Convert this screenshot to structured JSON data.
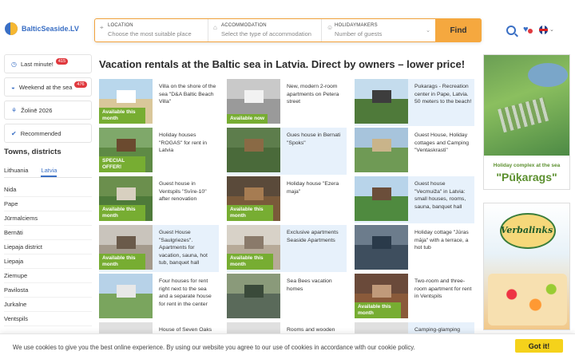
{
  "header": {
    "logo_text": "BalticSeaside.LV",
    "fields": [
      {
        "label": "LOCATION",
        "placeholder": "Choose the most suitable place"
      },
      {
        "label": "ACCOMMODATION",
        "placeholder": "Select the type of accommodation"
      },
      {
        "label": "HOLIDAYMAKERS",
        "placeholder": "Number of guests"
      }
    ],
    "find_label": "Find"
  },
  "sidebar": {
    "buttons": [
      {
        "label": "Last minute!",
        "badge": "415",
        "icon": "clock-icon"
      },
      {
        "label": "Weekend at the sea",
        "badge": "476",
        "icon": "wave-icon"
      },
      {
        "label": "Žolinē 2026",
        "badge": "",
        "icon": "grass-icon"
      },
      {
        "label": "Recommended",
        "badge": "",
        "icon": "thumbs-up-icon"
      }
    ],
    "towns_title": "Towns, districts",
    "tabs": [
      "Lithuania",
      "Latvia"
    ],
    "active_tab": "Latvia",
    "towns": [
      "Nida",
      "Pape",
      "Jūrmalciems",
      "Bernāti",
      "Liepaja district",
      "Liepaja",
      "Ziemupe",
      "Pavilosta",
      "Jurkalne",
      "Ventspils"
    ]
  },
  "main": {
    "title": "Vacation rentals at the Baltic sea in Latvia. Direct by owners – lower price!",
    "listings": [
      {
        "desc": "Villa on the shore of the sea \"D&A Baltic Beach Villa\"",
        "badge": "Available this month",
        "hl": false
      },
      {
        "desc": "New, modern 2-room apartments on Petera street",
        "badge": "Available now",
        "hl": false
      },
      {
        "desc": "Pukarags - Recreation center in Pape, Latvia. 50 meters to the beach!",
        "badge": "",
        "hl": true
      },
      {
        "desc": "Holiday houses \"ROGAS\" for rent in Latvia",
        "badge": "SPECIAL OFFER!",
        "hl": false
      },
      {
        "desc": "Gues house in Bernati \"Spoks\"",
        "badge": "",
        "hl": true
      },
      {
        "desc": "Guest House, Holiday cottages and Camping \"Ventaskrasti\"",
        "badge": "",
        "hl": false
      },
      {
        "desc": "Guest house in Ventspils \"Svīre-10\" after renovation",
        "badge": "Available this month",
        "hl": false
      },
      {
        "desc": "Holiday house \"Ezera maja\"",
        "badge": "Available this month",
        "hl": false
      },
      {
        "desc": "Guest house \"Vecmuiža\" in Latvia: small houses, rooms, sauna, banquet hall",
        "badge": "",
        "hl": true
      },
      {
        "desc": "Guest House \"Saulgriezes\". Apartments for vacation, sauna, hot tub, banquet hall",
        "badge": "Available this month",
        "hl": true
      },
      {
        "desc": "Exclusive apartments Seaside Apartments",
        "badge": "Available this month",
        "hl": true
      },
      {
        "desc": "Holiday cottage \"Jūras māja\" with a terrace, a hot tub",
        "badge": "",
        "hl": false
      },
      {
        "desc": "Four houses for rent right next to the sea and a separate house for rent in the center",
        "badge": "",
        "hl": false
      },
      {
        "desc": "Sea Bees vacation homes",
        "badge": "",
        "hl": false
      },
      {
        "desc": "Two-room and three-room apartment for rent in Ventspils",
        "badge": "Available this month",
        "hl": false
      },
      {
        "desc": "House of Seven Oaks",
        "badge": "",
        "hl": false
      },
      {
        "desc": "Rooms and wooden",
        "badge": "",
        "hl": false
      },
      {
        "desc": "Camping-glamping",
        "badge": "",
        "hl": true
      }
    ]
  },
  "ads": {
    "ad1_line1": "Holiday complex at the sea",
    "ad1_line2": "\"Pūķarags\"",
    "ad2_brand": "Verbalinks"
  },
  "cookie": {
    "text": "We use cookies to give you the best online experience. By using our website you agree to our use of cookies in accordance with our cookie policy.",
    "button": "Got it!"
  },
  "colors": {
    "accent": "#3a6fc4",
    "find": "#f5a83f",
    "badge_green": "#77ad32",
    "cookie_btn": "#f5d21b"
  }
}
